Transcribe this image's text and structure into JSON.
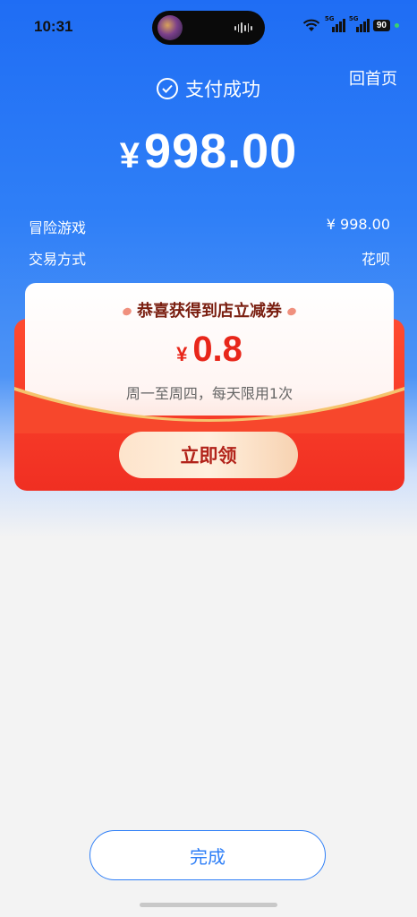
{
  "status_bar": {
    "time": "10:31",
    "battery": "90",
    "network_tag_1": "5G",
    "network_tag_2": "5G"
  },
  "header": {
    "home_link": "回首页",
    "status_text": "支付成功",
    "currency_symbol": "¥",
    "amount": "998.00"
  },
  "details": [
    {
      "label": "冒险游戏",
      "value": "¥ 998.00"
    },
    {
      "label": "交易方式",
      "value": "花呗"
    }
  ],
  "coupon": {
    "title": "恭喜获得到店立减券",
    "currency_symbol": "¥",
    "value": "0.8",
    "rule": "周一至周四，每天限用1次",
    "claim_label": "立即领"
  },
  "footer": {
    "done_label": "完成"
  },
  "colors": {
    "primary_blue": "#2f7ff7",
    "coupon_red": "#f02f22"
  }
}
